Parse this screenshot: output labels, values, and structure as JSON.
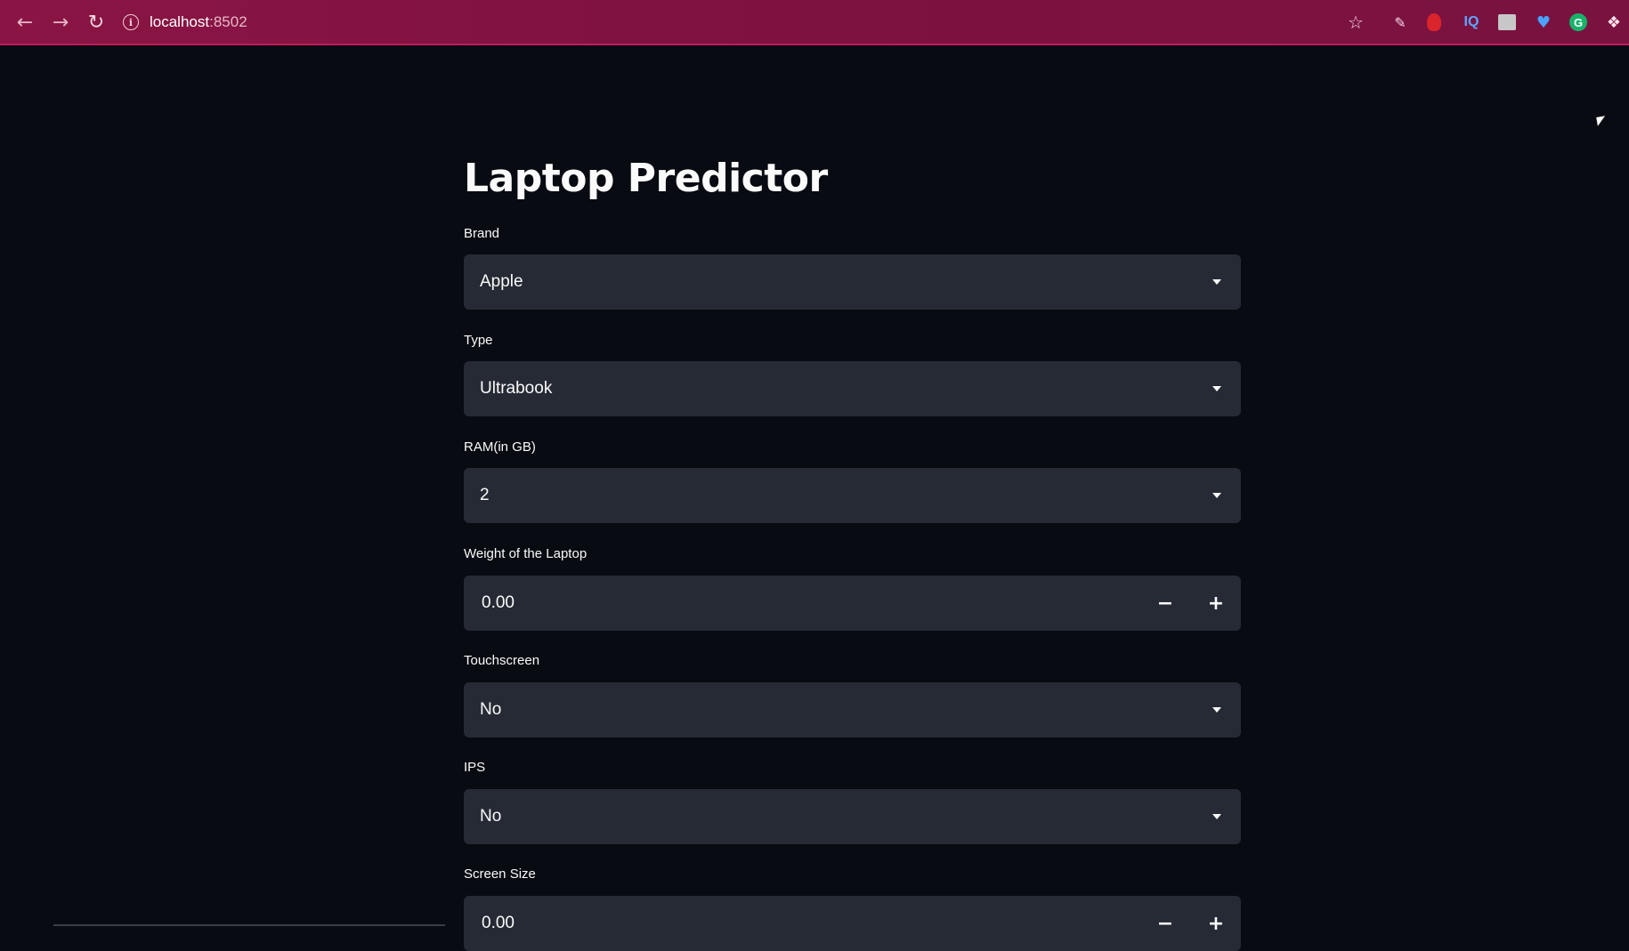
{
  "browser": {
    "url_host": "localhost",
    "url_port": ":8502"
  },
  "app": {
    "title": "Laptop Predictor",
    "fields": [
      {
        "label": "Brand",
        "type": "select",
        "value": "Apple"
      },
      {
        "label": "Type",
        "type": "select",
        "value": "Ultrabook"
      },
      {
        "label": "RAM(in GB)",
        "type": "select",
        "value": "2"
      },
      {
        "label": "Weight of the Laptop",
        "type": "number",
        "value": "0.00"
      },
      {
        "label": "Touchscreen",
        "type": "select",
        "value": "No"
      },
      {
        "label": "IPS",
        "type": "select",
        "value": "No"
      },
      {
        "label": "Screen Size",
        "type": "number",
        "value": "0.00"
      }
    ]
  },
  "colors": {
    "chrome_bg": "#7d1140",
    "page_bg": "#080b12",
    "widget_bg": "#262a35",
    "text": "#fafafa"
  }
}
